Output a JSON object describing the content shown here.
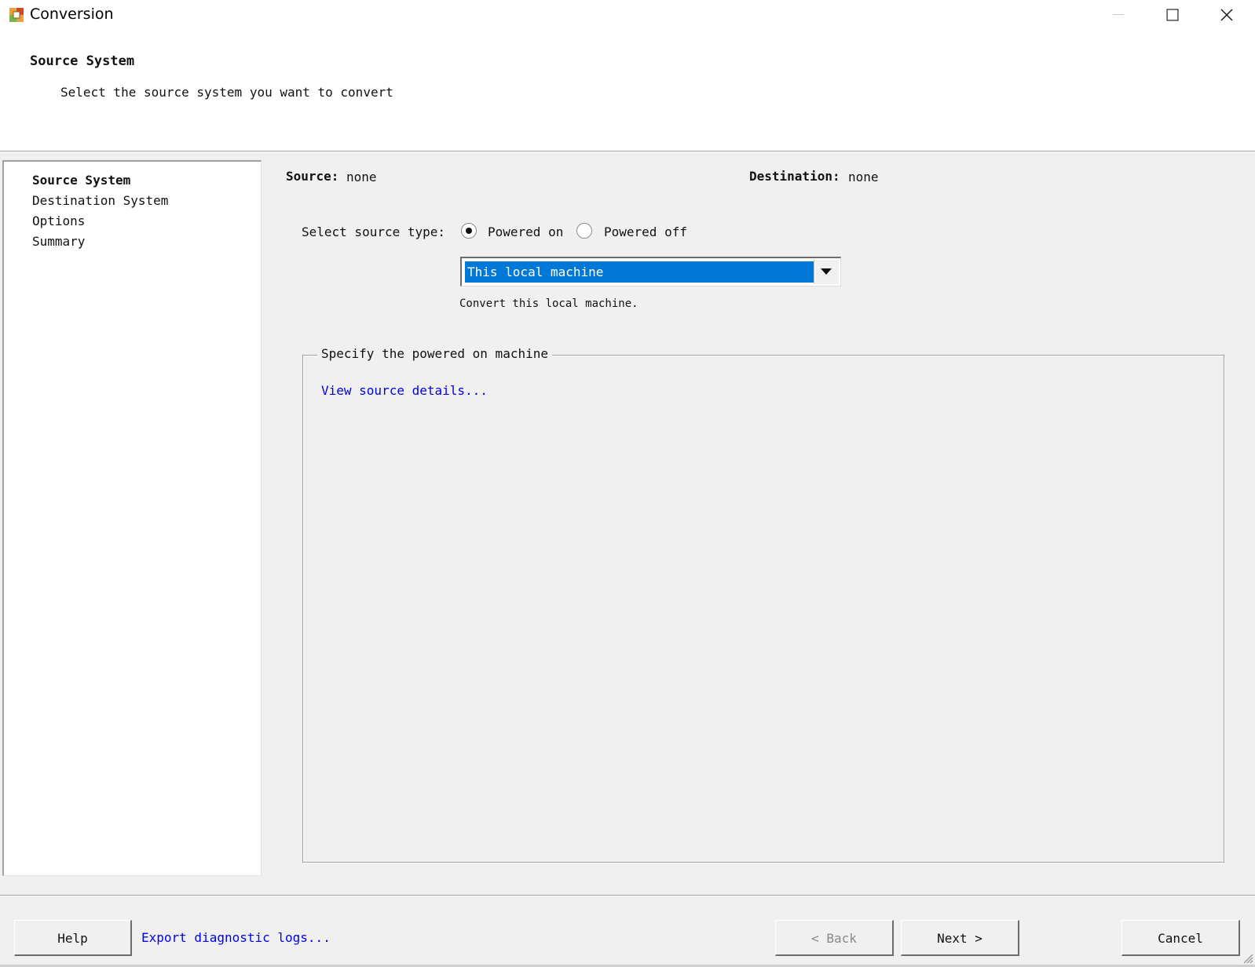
{
  "window": {
    "title": "Conversion",
    "minimize_icon": "minimize-icon",
    "maximize_icon": "maximize-icon",
    "close_icon": "close-icon",
    "app_icon": "converter-app-icon"
  },
  "header": {
    "title": "Source System",
    "subtitle": "Select the source system you want to convert"
  },
  "nav": {
    "items": [
      {
        "label": "Source System",
        "active": true
      },
      {
        "label": "Destination System",
        "active": false
      },
      {
        "label": "Options",
        "active": false
      },
      {
        "label": "Summary",
        "active": false
      }
    ]
  },
  "summary": {
    "source_label": "Source:",
    "source_value": "none",
    "destination_label": "Destination:",
    "destination_value": "none"
  },
  "source_type": {
    "label": "Select source type:",
    "options": [
      {
        "label": "Powered on",
        "selected": true
      },
      {
        "label": "Powered off",
        "selected": false
      }
    ]
  },
  "machine_select": {
    "value": "This local machine",
    "hint": "Convert this local machine."
  },
  "group": {
    "legend": "Specify the powered on machine",
    "link": "View source details..."
  },
  "footer": {
    "help": "Help",
    "export_logs": "Export diagnostic logs...",
    "back": "< Back",
    "next": "Next >",
    "cancel": "Cancel"
  },
  "colors": {
    "selection": "#0078d7",
    "link": "#0000ee",
    "background": "#f0f0f0"
  }
}
